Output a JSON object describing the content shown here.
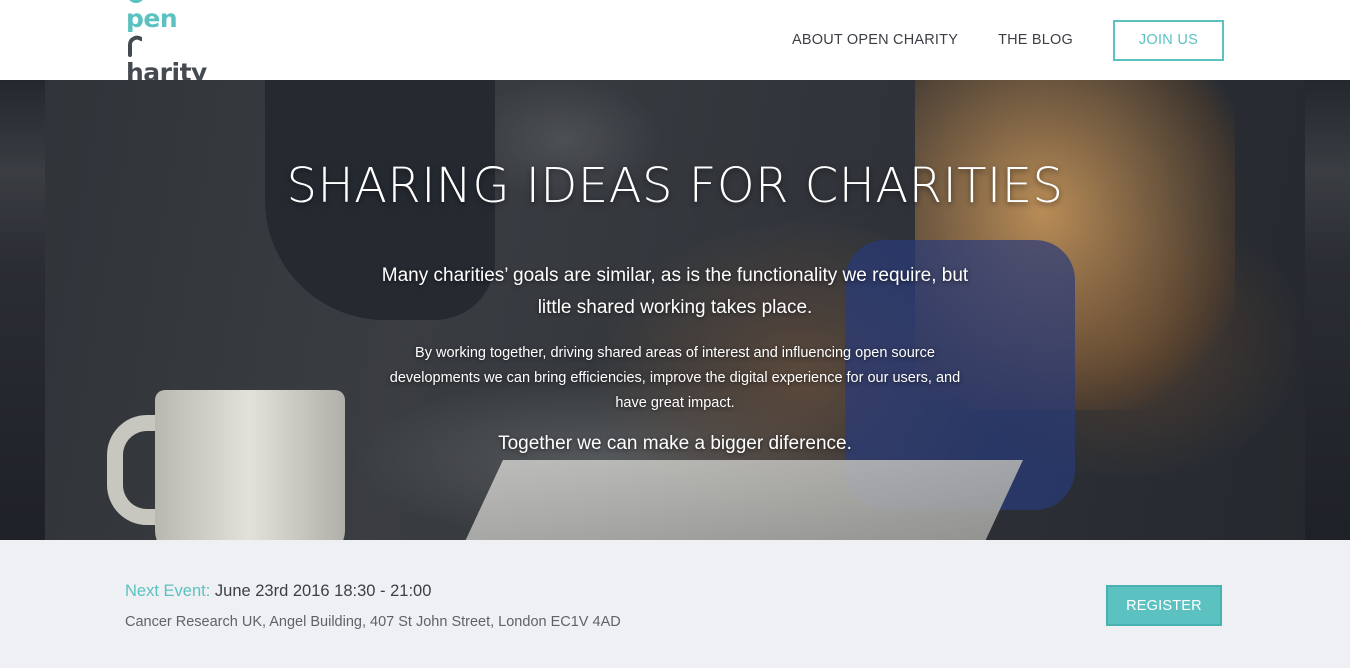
{
  "colors": {
    "accent": "#5bc2c1",
    "logo_dark": "#454a51",
    "event_bar_bg": "#eff0f4"
  },
  "header": {
    "logo": {
      "part1": "pen",
      "part2": "harity",
      "icon": "logo-open-charity-icon"
    },
    "nav": {
      "about": "ABOUT OPEN CHARITY",
      "blog": "THE BLOG",
      "join": "JOIN US"
    }
  },
  "hero": {
    "title": "SHARING IDEAS FOR CHARITIES",
    "lead": "Many charities’ goals are similar, as is the functionality we require, but little shared working takes place.",
    "body": "By working together, driving shared areas of interest and influencing open source developments we can bring efficiencies, improve the digital experience for our users, and have great impact.",
    "together": "Together we can make a bigger diference."
  },
  "event": {
    "label": "Next Event:",
    "datetime": "June 23rd 2016 18:30 - 21:00",
    "location": "Cancer Research UK, Angel Building, 407 St John Street, London EC1V 4AD",
    "register": "REGISTER"
  }
}
